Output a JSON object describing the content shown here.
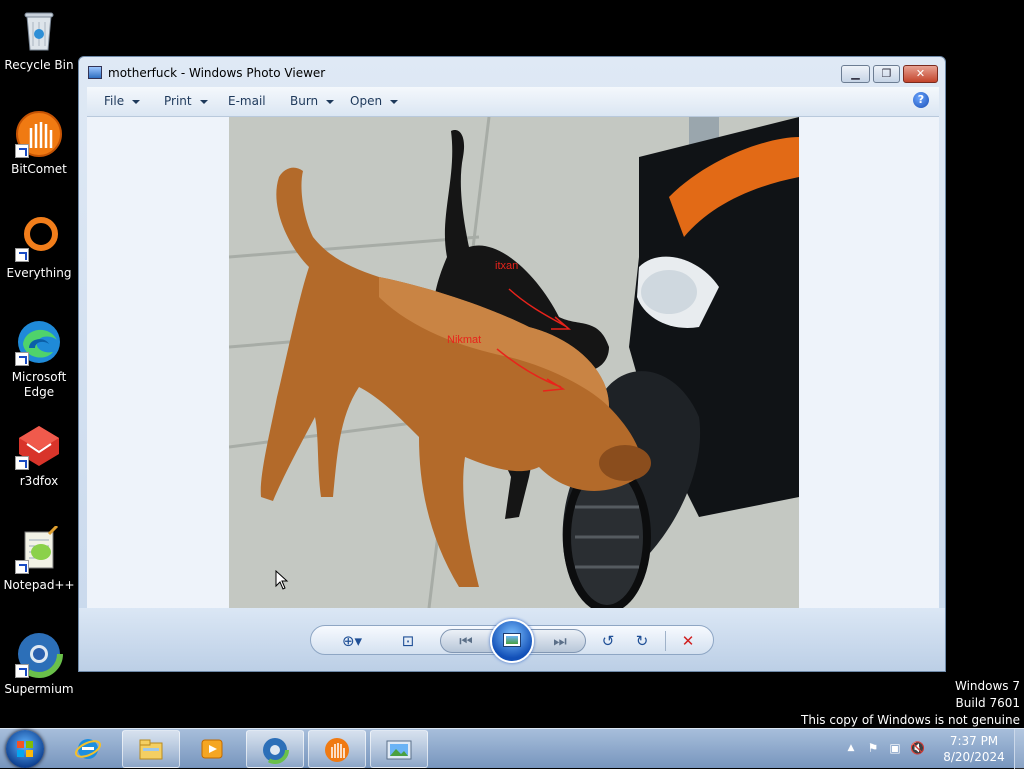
{
  "desktop": {
    "icons": [
      {
        "label": "Recycle Bin",
        "icon": "recycle-bin-icon"
      },
      {
        "label": "BitComet",
        "icon": "bitcomet-icon"
      },
      {
        "label": "Everything",
        "icon": "everything-icon"
      },
      {
        "label": "Microsoft Edge",
        "icon": "edge-icon"
      },
      {
        "label": "r3dfox",
        "icon": "r3dfox-icon"
      },
      {
        "label": "Notepad++",
        "icon": "notepadpp-icon"
      },
      {
        "label": "Supermium",
        "icon": "supermium-icon"
      }
    ]
  },
  "window": {
    "title": "motherfuck - Windows Photo Viewer",
    "menu": {
      "file": "File",
      "print": "Print",
      "email": "E-mail",
      "burn": "Burn",
      "open": "Open"
    },
    "photo": {
      "annotation_1": "itxan",
      "annotation_2": "Nikmat"
    },
    "controls": {
      "zoom": "zoom-icon",
      "actual_size": "fit-window-icon",
      "previous": "previous-icon",
      "slideshow": "slideshow-icon",
      "next": "next-icon",
      "rotate_ccw": "rotate-counterclockwise-icon",
      "rotate_cw": "rotate-clockwise-icon",
      "delete": "delete-icon"
    }
  },
  "watermark": {
    "line1": "Windows 7",
    "line2": "Build 7601",
    "line3": "This copy of Windows is not genuine"
  },
  "taskbar": {
    "pinned": [
      "internet-explorer-icon",
      "file-explorer-icon",
      "media-player-icon",
      "supermium-icon",
      "bitcomet-icon",
      "photo-viewer-icon"
    ],
    "clock": {
      "time": "7:37 PM",
      "date": "8/20/2024"
    }
  },
  "colors": {
    "accent": "#1f4f96",
    "delete": "#d02020",
    "annotation": "#e8231b"
  }
}
